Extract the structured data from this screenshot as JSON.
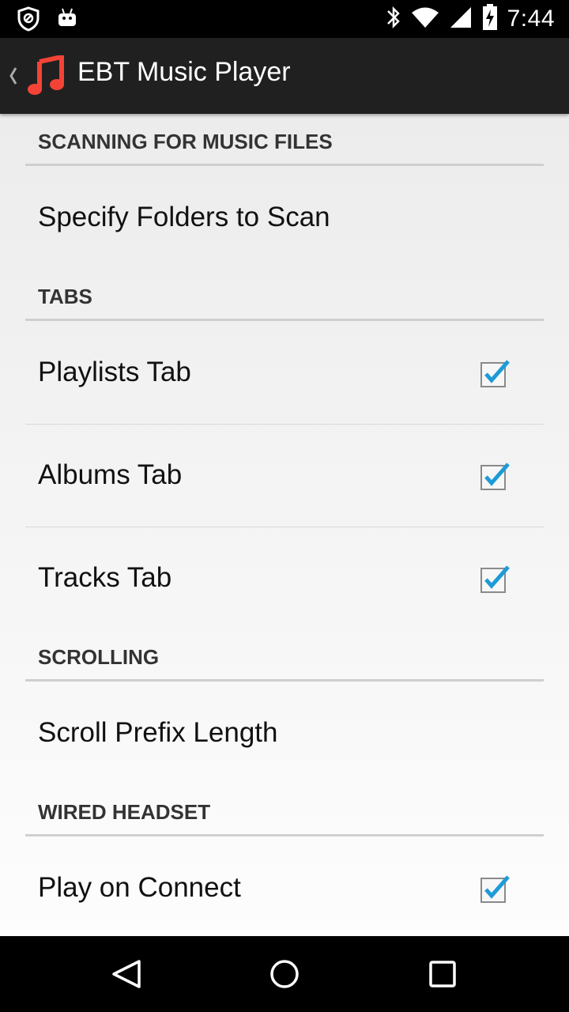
{
  "status_bar": {
    "time": "7:44",
    "left_icons": [
      "shield-icon",
      "android-icon"
    ],
    "right_icons": [
      "bluetooth-icon",
      "wifi-icon",
      "signal-icon",
      "battery-icon"
    ]
  },
  "action_bar": {
    "title": "EBT Music Player",
    "icon": "music-note-icon",
    "accent_color": "#f44336"
  },
  "settings": {
    "scanning_header": "SCANNING FOR MUSIC FILES",
    "specify_folders": "Specify Folders to Scan",
    "tabs_header": "TABS",
    "playlists_tab": "Playlists Tab",
    "playlists_checked": true,
    "albums_tab": "Albums Tab",
    "albums_checked": true,
    "tracks_tab": "Tracks Tab",
    "tracks_checked": true,
    "scrolling_header": "SCROLLING",
    "scroll_prefix": "Scroll Prefix Length",
    "headset_header": "WIRED HEADSET",
    "play_on_connect": "Play on Connect",
    "play_on_connect_checked": true
  },
  "colors": {
    "check_color": "#1e9bd7",
    "header_text": "#333333"
  },
  "nav_bar": {
    "buttons": [
      "back-icon",
      "home-icon",
      "recents-icon"
    ]
  }
}
